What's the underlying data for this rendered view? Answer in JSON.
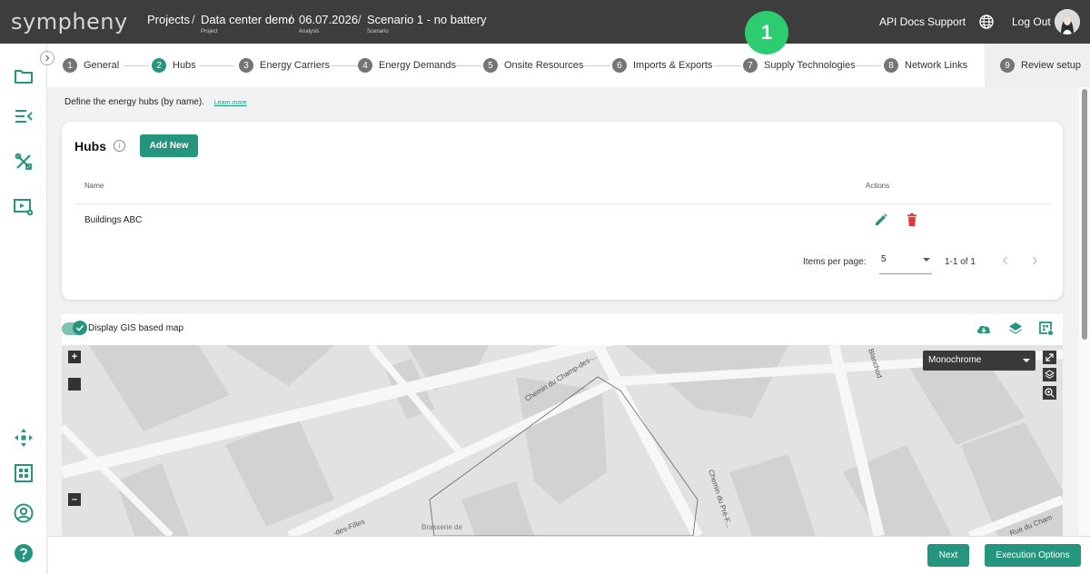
{
  "app": {
    "logo_text": "sympheny"
  },
  "breadcrumb": [
    {
      "label": "Projects",
      "sub": ""
    },
    {
      "label": "Data center demo",
      "sub": "Project"
    },
    {
      "label": "06.07.2026",
      "sub": "Analysis"
    },
    {
      "label": "Scenario 1 - no battery",
      "sub": "Scenario"
    }
  ],
  "breadcrumb_separator": "/",
  "topnav": {
    "api_docs": "API Docs",
    "support": "Support",
    "logout": "Log Out"
  },
  "badge": {
    "number": "1"
  },
  "stepper": {
    "steps": [
      {
        "num": "1",
        "label": "General"
      },
      {
        "num": "2",
        "label": "Hubs"
      },
      {
        "num": "3",
        "label": "Energy Carriers"
      },
      {
        "num": "4",
        "label": "Energy Demands"
      },
      {
        "num": "5",
        "label": "Onsite Resources"
      },
      {
        "num": "6",
        "label": "Imports & Exports"
      },
      {
        "num": "7",
        "label": "Supply Technologies"
      },
      {
        "num": "8",
        "label": "Network Links"
      },
      {
        "num": "9",
        "label": "Review setup"
      }
    ],
    "active": "2"
  },
  "intro": {
    "text": "Define the energy hubs (by name).",
    "learn_more": "Learn more"
  },
  "hubs_card": {
    "title": "Hubs",
    "add_button": "Add New",
    "columns": {
      "name": "Name",
      "actions": "Actions"
    },
    "rows": [
      {
        "name": "Buildings ABC"
      }
    ],
    "pagination": {
      "items_per_page_label": "Items per page:",
      "items_per_page_value": "5",
      "range": "1-1 of 1"
    }
  },
  "gis": {
    "toggle_label": "Display GIS based map",
    "toggle_on": true,
    "map_style": "Monochrome",
    "map_labels": [
      "Chemin du Champ-des-...",
      "Chemin du Pré-F...",
      "Blanchod",
      "-des-Filles",
      "Brasserie de",
      "Rue du Cham"
    ]
  },
  "footer": {
    "next": "Next",
    "execution_options": "Execution Options"
  },
  "colors": {
    "accent": "#26957e",
    "topbar": "#3d3d3d",
    "badge": "#2ecc71",
    "delete": "#e53935"
  }
}
